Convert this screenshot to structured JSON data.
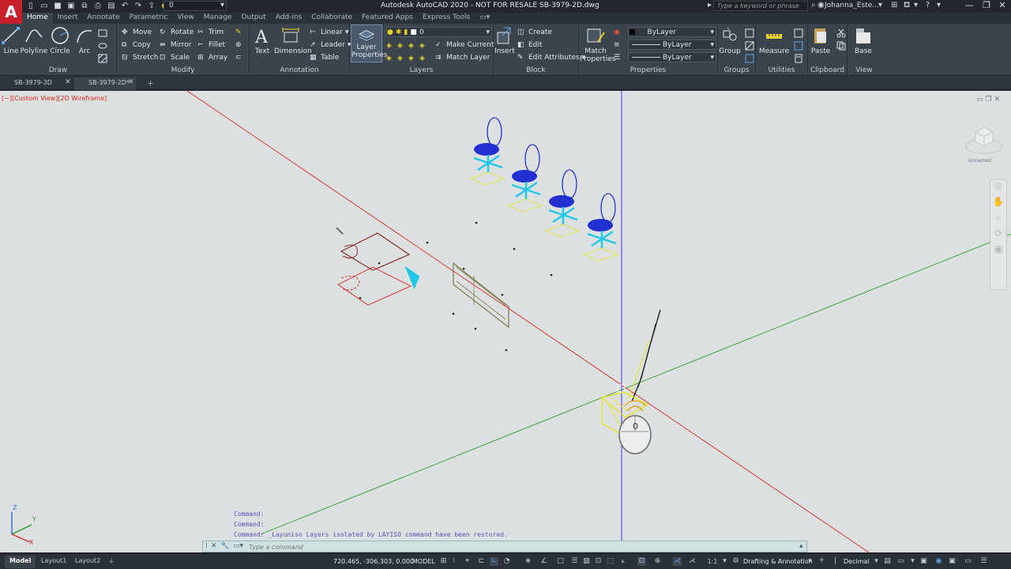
{
  "title_bar": {
    "app_logo": "A",
    "title": "Autodesk AutoCAD 2020 - NOT FOR RESALE   SB-3979-2D.dwg",
    "qat_layer": "0",
    "search_placeholder": "Type a keyword or phrase",
    "user": "Johanna_Este..."
  },
  "ribbon_tabs": [
    "Home",
    "Insert",
    "Annotate",
    "Parametric",
    "View",
    "Manage",
    "Output",
    "Add-ins",
    "Collaborate",
    "Featured Apps",
    "Express Tools"
  ],
  "ribbon": {
    "draw": {
      "title": "Draw",
      "line": "Line",
      "polyline": "Polyline",
      "circle": "Circle",
      "arc": "Arc"
    },
    "modify": {
      "title": "Modify",
      "move": "Move",
      "rotate": "Rotate",
      "trim": "Trim",
      "copy": "Copy",
      "mirror": "Mirror",
      "fillet": "Fillet",
      "stretch": "Stretch",
      "scale": "Scale",
      "array": "Array"
    },
    "annotation": {
      "title": "Annotation",
      "text": "Text",
      "dimension": "Dimension",
      "linear": "Linear",
      "leader": "Leader",
      "table": "Table"
    },
    "layers": {
      "title": "Layers",
      "layer_properties": "Layer Properties",
      "current_layer": "0",
      "make_current": "Make Current",
      "match_layer": "Match Layer"
    },
    "block": {
      "title": "Block",
      "insert": "Insert",
      "create": "Create",
      "edit": "Edit",
      "edit_attributes": "Edit Attributes"
    },
    "properties": {
      "title": "Properties",
      "match_properties": "Match Properties",
      "color": "ByLayer",
      "linetype": "ByLayer",
      "lineweight": "ByLayer"
    },
    "groups": {
      "title": "Groups",
      "group": "Group"
    },
    "utilities": {
      "title": "Utilities",
      "measure": "Measure"
    },
    "clipboard": {
      "title": "Clipboard",
      "paste": "Paste"
    },
    "view": {
      "title": "View",
      "base": "Base"
    }
  },
  "file_tabs": [
    "SB-3979-3D",
    "SB-3979-2D*"
  ],
  "viewport": {
    "label": "[−][Custom View][2D Wireframe]",
    "viewcube_label": "Unnamed",
    "ucs_x": "X",
    "ucs_y": "Y",
    "ucs_z": "Z",
    "mouse_wheel_label": "0"
  },
  "command": {
    "history": [
      "Command:",
      "Command:",
      "Command: _Layuniso Layers isolated by LAYISO command have been restored."
    ],
    "placeholder": "Type a command"
  },
  "status_bar": {
    "layout_tabs": [
      "Model",
      "Layout1",
      "Layout2"
    ],
    "coordinates": "720.465, -306.303, 0.000",
    "model": "MODEL",
    "scale": "1:1",
    "workspace": "Drafting & Annotation",
    "units": "Decimal"
  },
  "colors": {
    "accent": "#5aa7e6",
    "viewport_bg": "#dde0e0",
    "x_axis": "#d42a2a",
    "y_axis": "#2a9a2a",
    "z_axis": "#2a2aee",
    "chairs": "#2330d0",
    "chair_accent": "#22c8e6",
    "highlight": "#e6e61e"
  }
}
